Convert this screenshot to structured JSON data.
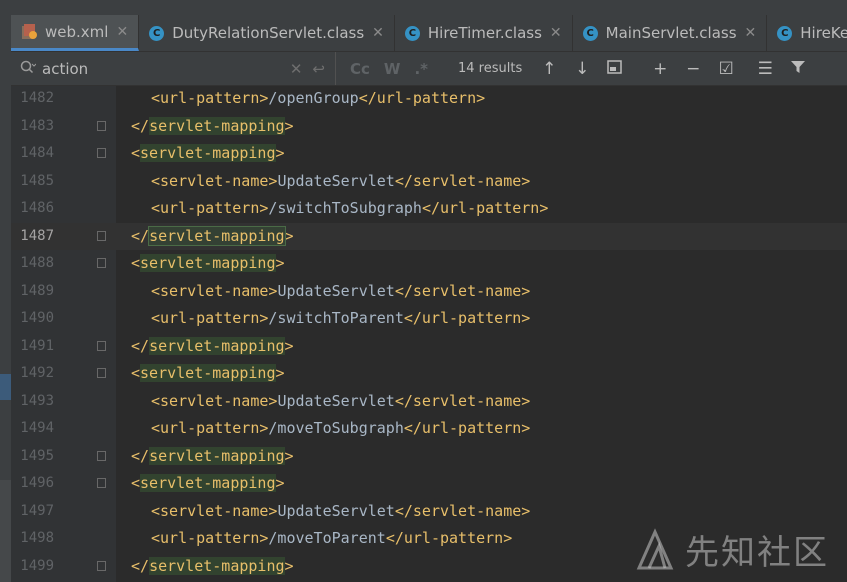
{
  "tabs": [
    {
      "label": "web.xml",
      "icon": "xml-file-icon",
      "active": true,
      "closable": true
    },
    {
      "label": "DutyRelationServlet.class",
      "icon": "class-icon",
      "active": false,
      "closable": true
    },
    {
      "label": "HireTimer.class",
      "icon": "class-icon",
      "active": false,
      "closable": true
    },
    {
      "label": "MainServlet.class",
      "icon": "class-icon",
      "active": false,
      "closable": true
    },
    {
      "label": "HireKeyw",
      "icon": "class-icon",
      "active": false,
      "closable": false
    }
  ],
  "find": {
    "query": "action",
    "results": "14 results",
    "match_case_label": "Cc",
    "words_label": "W",
    "regex_label": ".*"
  },
  "editor": {
    "current_line": "1487",
    "lines": [
      {
        "num": "1482",
        "indent": 2,
        "open": "<url-pattern>",
        "text": "/openGroup",
        "close": "</url-pattern>"
      },
      {
        "num": "1483",
        "indent": 1,
        "open": "</",
        "tag": "servlet-mapping",
        "end": ">"
      },
      {
        "num": "1484",
        "indent": 1,
        "open": "<",
        "tag": "servlet-mapping",
        "end": ">"
      },
      {
        "num": "1485",
        "indent": 2,
        "open": "<servlet-name>",
        "text": "UpdateServlet",
        "close": "</servlet-name>"
      },
      {
        "num": "1486",
        "indent": 2,
        "open": "<url-pattern>",
        "text": "/switchToSubgraph",
        "close": "</url-pattern>"
      },
      {
        "num": "1487",
        "indent": 1,
        "open": "</",
        "tag": "servlet-mapping",
        "end": ">"
      },
      {
        "num": "1488",
        "indent": 1,
        "open": "<",
        "tag": "servlet-mapping",
        "end": ">"
      },
      {
        "num": "1489",
        "indent": 2,
        "open": "<servlet-name>",
        "text": "UpdateServlet",
        "close": "</servlet-name>"
      },
      {
        "num": "1490",
        "indent": 2,
        "open": "<url-pattern>",
        "text": "/switchToParent",
        "close": "</url-pattern>"
      },
      {
        "num": "1491",
        "indent": 1,
        "open": "</",
        "tag": "servlet-mapping",
        "end": ">"
      },
      {
        "num": "1492",
        "indent": 1,
        "open": "<",
        "tag": "servlet-mapping",
        "end": ">"
      },
      {
        "num": "1493",
        "indent": 2,
        "open": "<servlet-name>",
        "text": "UpdateServlet",
        "close": "</servlet-name>"
      },
      {
        "num": "1494",
        "indent": 2,
        "open": "<url-pattern>",
        "text": "/moveToSubgraph",
        "close": "</url-pattern>"
      },
      {
        "num": "1495",
        "indent": 1,
        "open": "</",
        "tag": "servlet-mapping",
        "end": ">"
      },
      {
        "num": "1496",
        "indent": 1,
        "open": "<",
        "tag": "servlet-mapping",
        "end": ">"
      },
      {
        "num": "1497",
        "indent": 2,
        "open": "<servlet-name>",
        "text": "UpdateServlet",
        "close": "</servlet-name>"
      },
      {
        "num": "1498",
        "indent": 2,
        "open": "<url-pattern>",
        "text": "/moveToParent",
        "close": "</url-pattern>"
      },
      {
        "num": "1499",
        "indent": 1,
        "open": "</",
        "tag": "servlet-mapping",
        "end": ">"
      }
    ]
  },
  "watermark": {
    "text": "先知社区"
  },
  "colors": {
    "tag": "#e8bf6a",
    "text": "#a9b7c6",
    "tag_highlight": "#32432f",
    "active_tab_underline": "#4a88c7",
    "class_icon": "#3592c4"
  }
}
